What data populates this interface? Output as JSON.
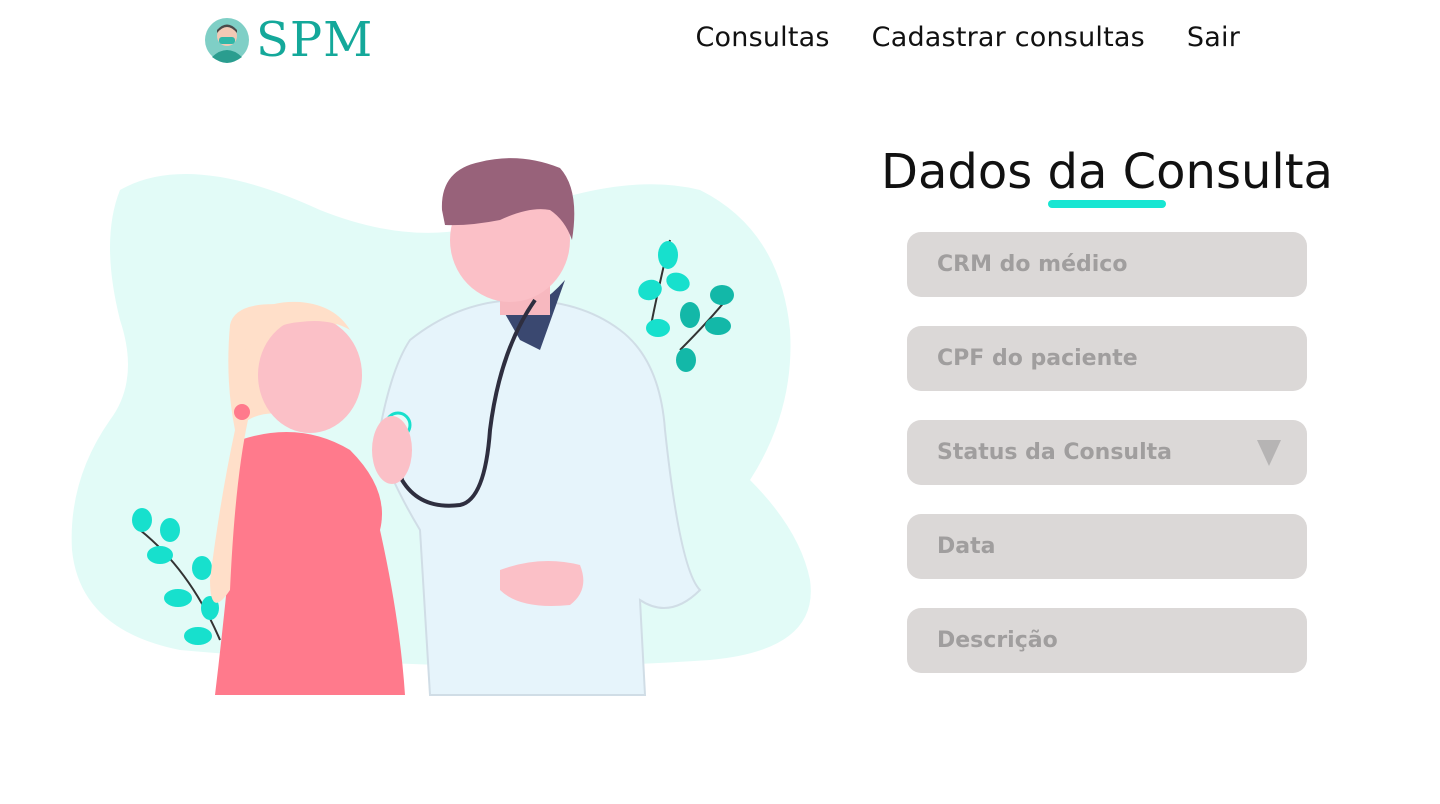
{
  "app": {
    "logo_text": "SPM",
    "brand_color": "#14a89a",
    "accent_color": "#17e6d2",
    "logo_icon": "doctor-avatar-icon"
  },
  "nav": {
    "items": [
      {
        "label": "Consultas"
      },
      {
        "label": "Cadastrar consultas"
      },
      {
        "label": "Sair"
      }
    ]
  },
  "illustration": {
    "icon": "doctor-patient-illustration"
  },
  "form": {
    "title": "Dados da Consulta",
    "fields": [
      {
        "placeholder": "CRM do médico",
        "value": ""
      },
      {
        "placeholder": "CPF do paciente",
        "value": ""
      },
      {
        "placeholder": "Status da Consulta",
        "type": "select",
        "icon": "chevron-down-icon"
      },
      {
        "placeholder": "Data",
        "value": ""
      },
      {
        "placeholder": "Descrição",
        "value": ""
      }
    ],
    "field_bg_color": "#dbd8d7",
    "placeholder_color": "#a09e9e"
  }
}
